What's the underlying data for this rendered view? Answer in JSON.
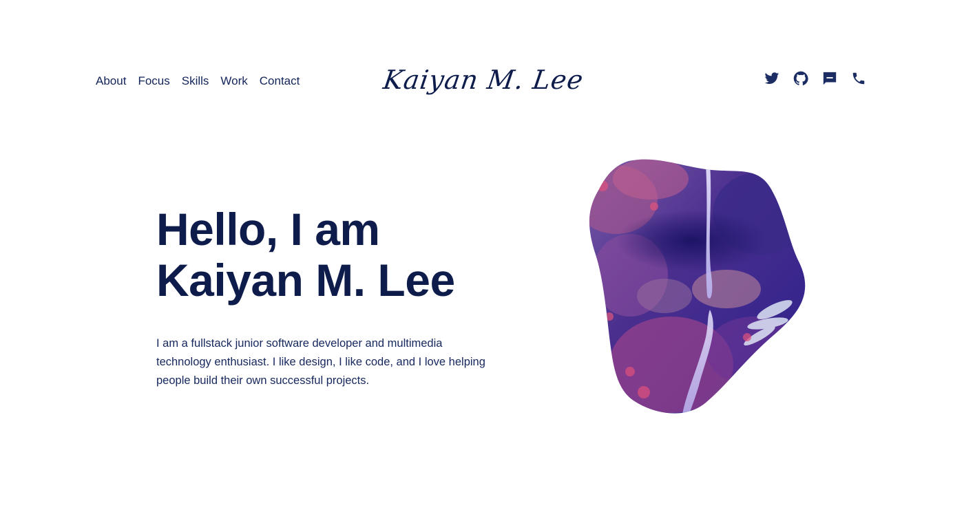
{
  "nav": {
    "items": [
      {
        "label": "About"
      },
      {
        "label": "Focus"
      },
      {
        "label": "Skills"
      },
      {
        "label": "Work"
      },
      {
        "label": "Contact"
      }
    ]
  },
  "logo": {
    "text": "Kaiyan M. Lee"
  },
  "social": {
    "icons": [
      "twitter-icon",
      "github-icon",
      "message-icon",
      "phone-icon"
    ]
  },
  "hero": {
    "title_line1": "Hello, I am",
    "title_line2": "Kaiyan M. Lee",
    "description": "I am a fullstack junior software developer and multimedia technology enthusiast. I like design, I like code, and I love helping people build their own successful projects."
  },
  "colors": {
    "primary": "#0d1c4a",
    "accent": "#2b2594",
    "background": "#ffffff"
  }
}
